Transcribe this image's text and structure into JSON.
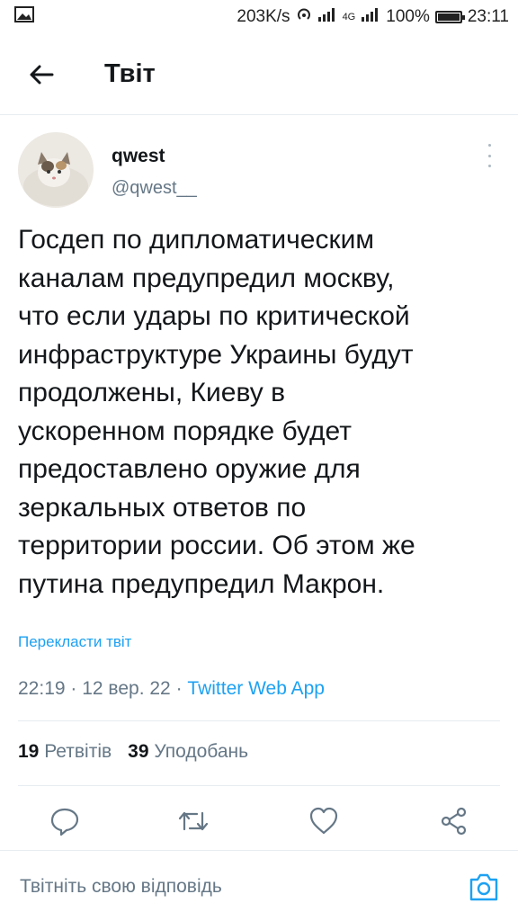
{
  "status_bar": {
    "gallery_icon": "image-icon",
    "speed": "203K/s",
    "network_label": "4G",
    "battery": "100%",
    "time": "23:11"
  },
  "header": {
    "back_icon": "arrow-left-icon",
    "title": "Твіт"
  },
  "tweet": {
    "display_name": "qwest",
    "handle": "@qwest__",
    "text": "Госдеп по дипломатическим\nканалам предупредил москву,\nчто если удары по критической\nинфраструктуре Украины будут\nпродолжены, Киеву в\nускоренном порядке будет\nпредоставлено оружие для\nзеркальных ответов по\nтерритории россии. Об этом же\nпутина предупредил Макрон.",
    "translate_label": "Перекласти твіт",
    "time": "22:19",
    "date": "12 вер. 22",
    "source": "Twitter Web App",
    "separator": " · "
  },
  "stats": {
    "retweets_count": "19",
    "retweets_label": "Ретвітів",
    "likes_count": "39",
    "likes_label": "Уподобань"
  },
  "reply_bar": {
    "placeholder": "Твітніть свою відповідь"
  },
  "colors": {
    "accent": "#1da1f2",
    "secondary_text": "#657786",
    "divider": "#e6ecf0"
  }
}
